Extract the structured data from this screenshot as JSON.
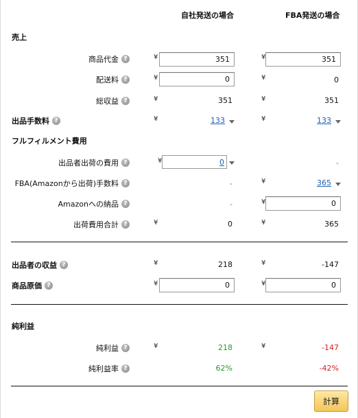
{
  "headers": {
    "self": "自社発送の場合",
    "fba": "FBA発送の場合"
  },
  "currency": "¥",
  "help_glyph": "?",
  "sections": {
    "sales": "売上",
    "fulfillment": "フルフィルメント費用",
    "net_profit": "純利益"
  },
  "rows": {
    "price": {
      "label": "商品代金",
      "self": "351",
      "fba": "351"
    },
    "shipping": {
      "label": "配送料",
      "self": "0",
      "fba": "0"
    },
    "total_revenue": {
      "label": "総収益",
      "self": "351",
      "fba": "351"
    },
    "selling_fee": {
      "label": "出品手数料",
      "self": "133",
      "fba": "133"
    },
    "seller_ship_cost": {
      "label": "出品者出荷の費用",
      "self": "0",
      "fba": "-"
    },
    "fba_fee": {
      "label": "FBA(Amazonから出荷)手数料",
      "self": "-",
      "fba": "365"
    },
    "inbound": {
      "label": "Amazonへの納品",
      "self": "-",
      "fba": "0"
    },
    "ship_total": {
      "label": "出荷費用合計",
      "self": "0",
      "fba": "365"
    },
    "seller_proceeds": {
      "label": "出品者の収益",
      "self": "218",
      "fba": "-147"
    },
    "cost": {
      "label": "商品原価",
      "self": "0",
      "fba": "0"
    },
    "net": {
      "label": "純利益",
      "self": "218",
      "fba": "-147"
    },
    "margin": {
      "label": "純利益率",
      "self": "62%",
      "fba": "-42%"
    }
  },
  "calc_button": "計算",
  "colors": {
    "positive": "#2a9a2a",
    "negative": "#d61f1f",
    "link": "#1a5fb4",
    "button": "#f4c65a"
  }
}
